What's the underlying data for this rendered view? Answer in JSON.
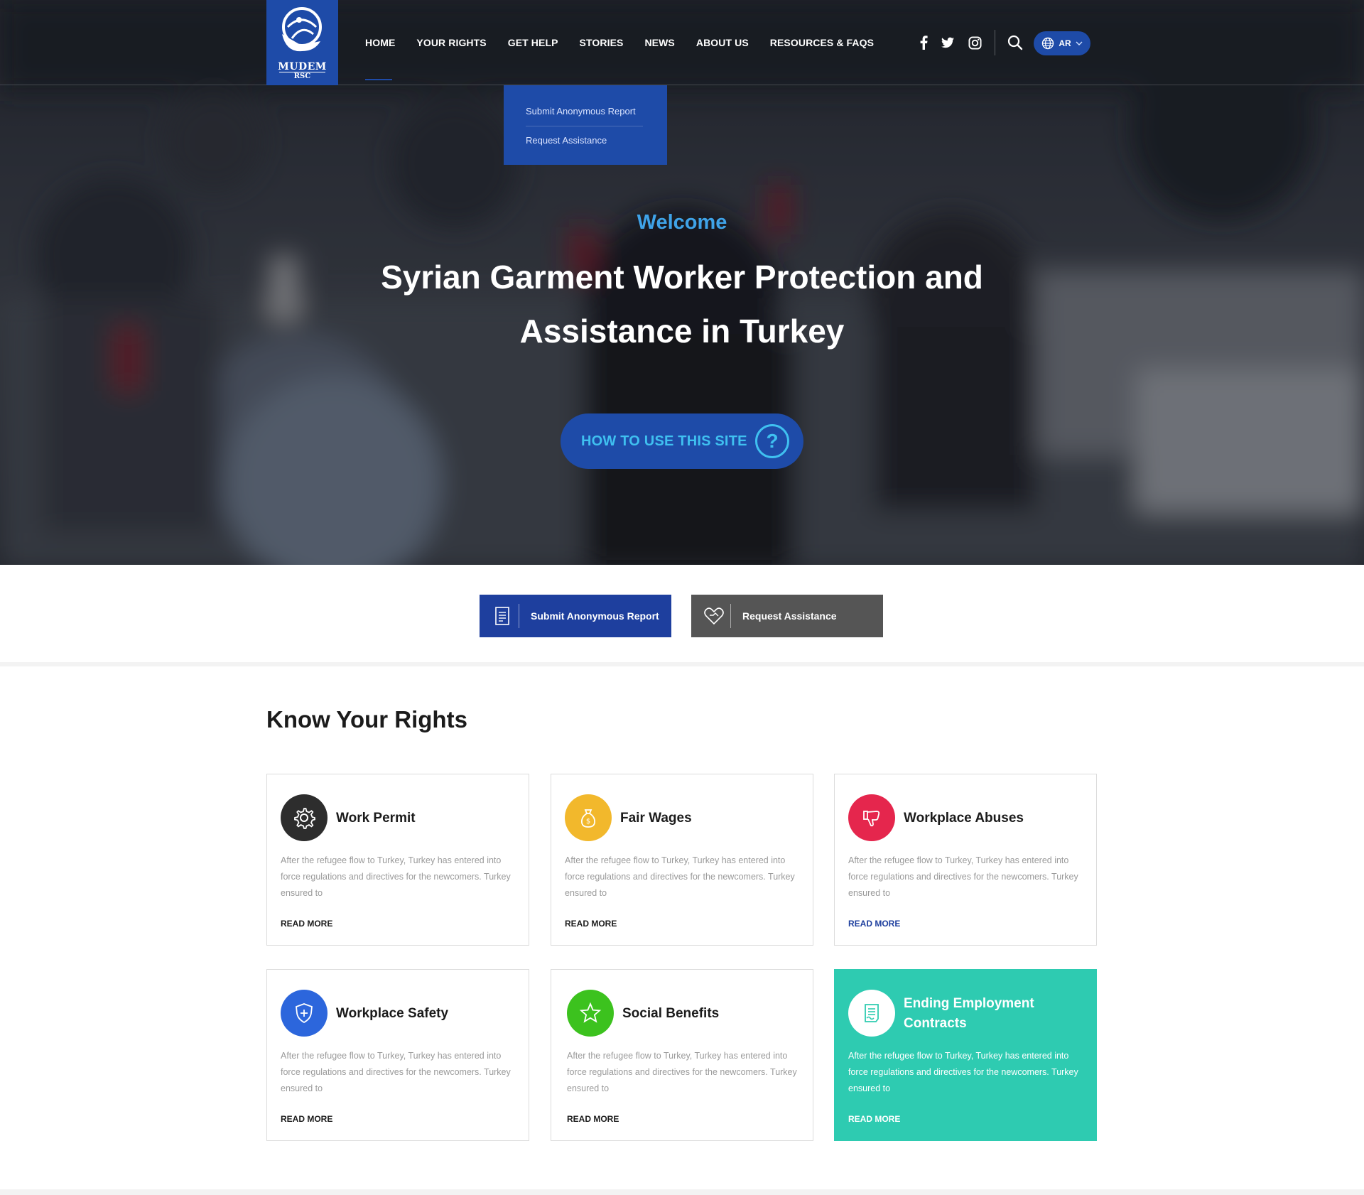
{
  "brand": {
    "name": "MUDEM",
    "sub": "RSC",
    "primary_color": "#1e4ba8",
    "accent_color": "#3fa3e8"
  },
  "nav": {
    "items": [
      {
        "label": "HOME"
      },
      {
        "label": "YOUR RIGHTS"
      },
      {
        "label": "GET HELP"
      },
      {
        "label": "STORIES"
      },
      {
        "label": "NEWS"
      },
      {
        "label": "ABOUT US"
      },
      {
        "label": "RESOURCES & FAQS"
      }
    ],
    "social": [
      "facebook-icon",
      "twitter-icon",
      "instagram-icon"
    ],
    "search_icon": "search-icon",
    "language": "AR"
  },
  "dropdown": {
    "items": [
      {
        "label": "Submit Anonymous Report"
      },
      {
        "label": "Request Assistance"
      }
    ]
  },
  "hero": {
    "welcome": "Welcome",
    "title": "Syrian Garment Worker Protection and Assistance in Turkey",
    "how_button": "HOW TO USE THIS SITE"
  },
  "actions": {
    "report_label": "Submit Anonymous Report",
    "assist_label": "Request Assistance"
  },
  "rights": {
    "title": "Know Your Rights",
    "cards": [
      {
        "title": "Work Permit",
        "text": "After the refugee flow to Turkey, Turkey has entered into force regulations and directives for the newcomers. Turkey ensured to",
        "more": "READ MORE",
        "icon": "gear-icon",
        "color": "#2d2d2d"
      },
      {
        "title": "Fair Wages",
        "text": "After the refugee flow to Turkey, Turkey has entered into force regulations and directives for the newcomers. Turkey ensured to",
        "more": "READ MORE",
        "icon": "money-bag-icon",
        "color": "#f2b82c"
      },
      {
        "title": "Workplace Abuses",
        "text": "After the refugee flow to Turkey, Turkey has entered into force regulations and directives for the newcomers. Turkey ensured to",
        "more": "READ MORE",
        "icon": "thumbs-down-icon",
        "color": "#e5264d"
      },
      {
        "title": "Workplace Safety",
        "text": "After the refugee flow to Turkey, Turkey has entered into force regulations and directives for the newcomers. Turkey ensured to",
        "more": "READ MORE",
        "icon": "shield-icon",
        "color": "#2c66dc"
      },
      {
        "title": "Social Benefits",
        "text": "After the refugee flow to Turkey, Turkey has entered into force regulations and directives for the newcomers. Turkey ensured to",
        "more": "READ MORE",
        "icon": "star-icon",
        "color": "#3cc21e"
      },
      {
        "title": "Ending Employment Contracts",
        "text": "After the refugee flow to Turkey, Turkey has entered into force regulations and directives for the newcomers. Turkey ensured to",
        "more": "READ MORE",
        "icon": "document-icon",
        "color": "#2ecbb1"
      }
    ]
  }
}
